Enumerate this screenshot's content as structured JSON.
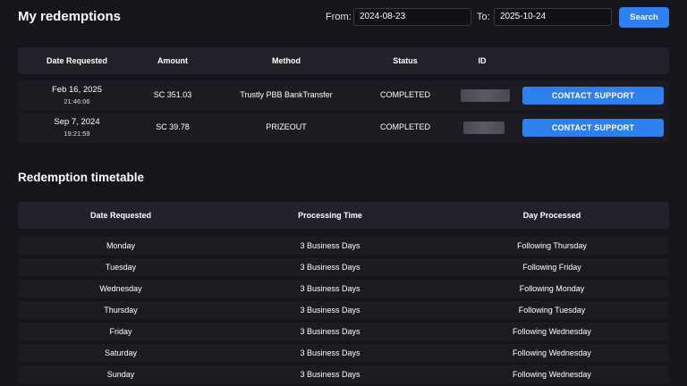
{
  "header": {
    "title": "My redemptions",
    "from_label": "From:",
    "from_value": "2024-08-23",
    "to_label": "To:",
    "to_value": "2025-10-24",
    "search_label": "Search"
  },
  "redemptions": {
    "columns": [
      "Date Requested",
      "Amount",
      "Method",
      "Status",
      "ID"
    ],
    "rows": [
      {
        "date": "Feb 16, 2025",
        "time": "21:46:06",
        "amount": "SC 351.03",
        "method": "Trustly PBB BankTransfer",
        "status": "COMPLETED",
        "action": "CONTACT SUPPORT"
      },
      {
        "date": "Sep 7, 2024",
        "time": "19:21:59",
        "amount": "SC 39.78",
        "method": "PRIZEOUT",
        "status": "COMPLETED",
        "action": "CONTACT SUPPORT"
      }
    ]
  },
  "timetable": {
    "title": "Redemption timetable",
    "columns": [
      "Date Requested",
      "Processing Time",
      "Day Processed"
    ],
    "rows": [
      {
        "day": "Monday",
        "processing": "3 Business Days",
        "processed": "Following Thursday"
      },
      {
        "day": "Tuesday",
        "processing": "3 Business Days",
        "processed": "Following Friday"
      },
      {
        "day": "Wednesday",
        "processing": "3 Business Days",
        "processed": "Following Monday"
      },
      {
        "day": "Thursday",
        "processing": "3 Business Days",
        "processed": "Following Tuesday"
      },
      {
        "day": "Friday",
        "processing": "3 Business Days",
        "processed": "Following Wednesday"
      },
      {
        "day": "Saturday",
        "processing": "3 Business Days",
        "processed": "Following Wednesday"
      },
      {
        "day": "Sunday",
        "processing": "3 Business Days",
        "processed": "Following Wednesday"
      }
    ]
  },
  "colors": {
    "background": "#16151b",
    "header_row": "#23222a",
    "row": "#1c1b22",
    "accent": "#2f80ef"
  }
}
